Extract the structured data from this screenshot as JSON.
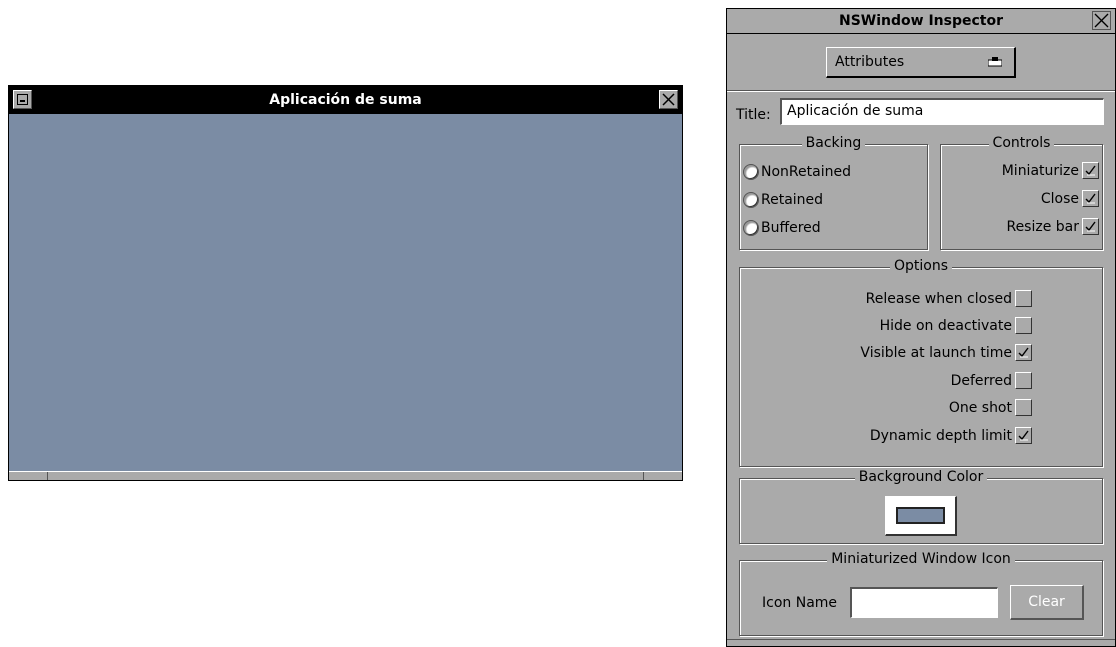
{
  "app_window": {
    "title": "Aplicación de suma",
    "background_color": "#7b8ca4"
  },
  "inspector": {
    "title": "NSWindow Inspector",
    "mode_popup": "Attributes",
    "title_label": "Title:",
    "title_value": "Aplicación de suma",
    "backing": {
      "label": "Backing",
      "options": [
        "NonRetained",
        "Retained",
        "Buffered"
      ]
    },
    "controls": {
      "label": "Controls",
      "items": [
        {
          "label": "Miniaturize",
          "checked": true
        },
        {
          "label": "Close",
          "checked": true
        },
        {
          "label": "Resize bar",
          "checked": true
        }
      ]
    },
    "options": {
      "label": "Options",
      "items": [
        {
          "label": "Release when closed",
          "checked": false
        },
        {
          "label": "Hide on deactivate",
          "checked": false
        },
        {
          "label": "Visible at launch time",
          "checked": true
        },
        {
          "label": "Deferred",
          "checked": false
        },
        {
          "label": "One shot",
          "checked": false
        },
        {
          "label": "Dynamic depth limit",
          "checked": true
        }
      ]
    },
    "background_color": {
      "label": "Background Color",
      "value": "#7b8ca4"
    },
    "mini_icon": {
      "label": "Miniaturized Window Icon",
      "icon_name_label": "Icon Name",
      "icon_name_value": "",
      "clear_label": "Clear"
    }
  }
}
